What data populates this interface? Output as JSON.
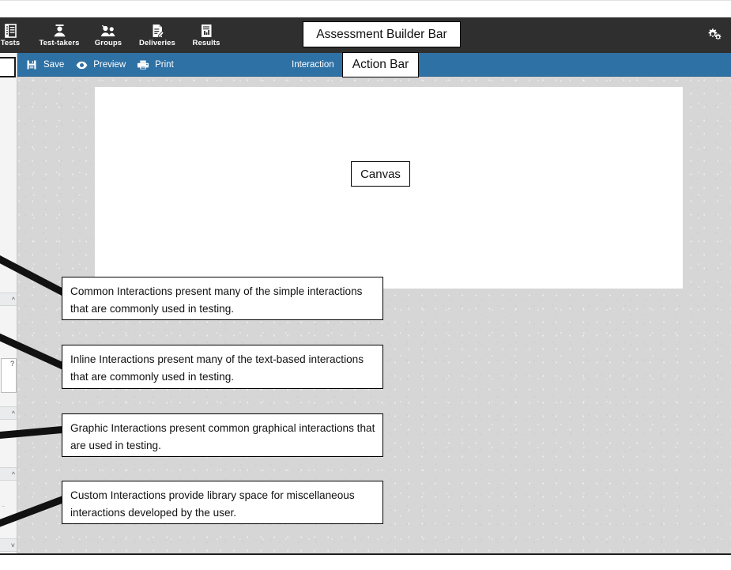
{
  "builder_bar": {
    "title_badge": "Assessment Builder Bar",
    "nav_items": [
      {
        "label": "Tests",
        "icon": "tests-icon"
      },
      {
        "label": "Test-takers",
        "icon": "test-taker-icon"
      },
      {
        "label": "Groups",
        "icon": "groups-icon"
      },
      {
        "label": "Deliveries",
        "icon": "deliveries-icon"
      },
      {
        "label": "Results",
        "icon": "results-icon"
      }
    ],
    "settings_icon": "gears-icon",
    "background_color": "#2f2f2f"
  },
  "action_bar": {
    "title_badge": "Action Bar",
    "background_color": "#2e71a5",
    "buttons": [
      {
        "label": "Save",
        "icon": "save-icon"
      },
      {
        "label": "Preview",
        "icon": "eye-icon"
      },
      {
        "label": "Print",
        "icon": "printer-icon"
      }
    ],
    "section_label": "Interaction"
  },
  "workspace": {
    "canvas_badge": "Canvas",
    "background_color": "#d6d6d6",
    "canvas_color": "#ffffff"
  },
  "sidebar": {
    "sections": [
      {
        "label": "",
        "chevron": "chevron-up-icon"
      },
      {
        "label": "",
        "chevron": "chevron-up-icon"
      },
      {
        "label": "",
        "chevron": "chevron-up-icon"
      },
      {
        "label": "",
        "chevron": "chevron-down-icon"
      }
    ],
    "tile_badge": "?",
    "truncated_label": "..."
  },
  "callouts": [
    {
      "id": "common",
      "text": "Common Interactions present many of the simple interactions that are commonly used in testing."
    },
    {
      "id": "inline",
      "text": "Inline Interactions present many of the text-based interactions that are commonly used in testing."
    },
    {
      "id": "graphic",
      "text": "Graphic Interactions present common graphical interactions that are used in testing."
    },
    {
      "id": "custom",
      "text": "Custom Interactions provide library space for miscellaneous interactions developed by the user."
    }
  ]
}
